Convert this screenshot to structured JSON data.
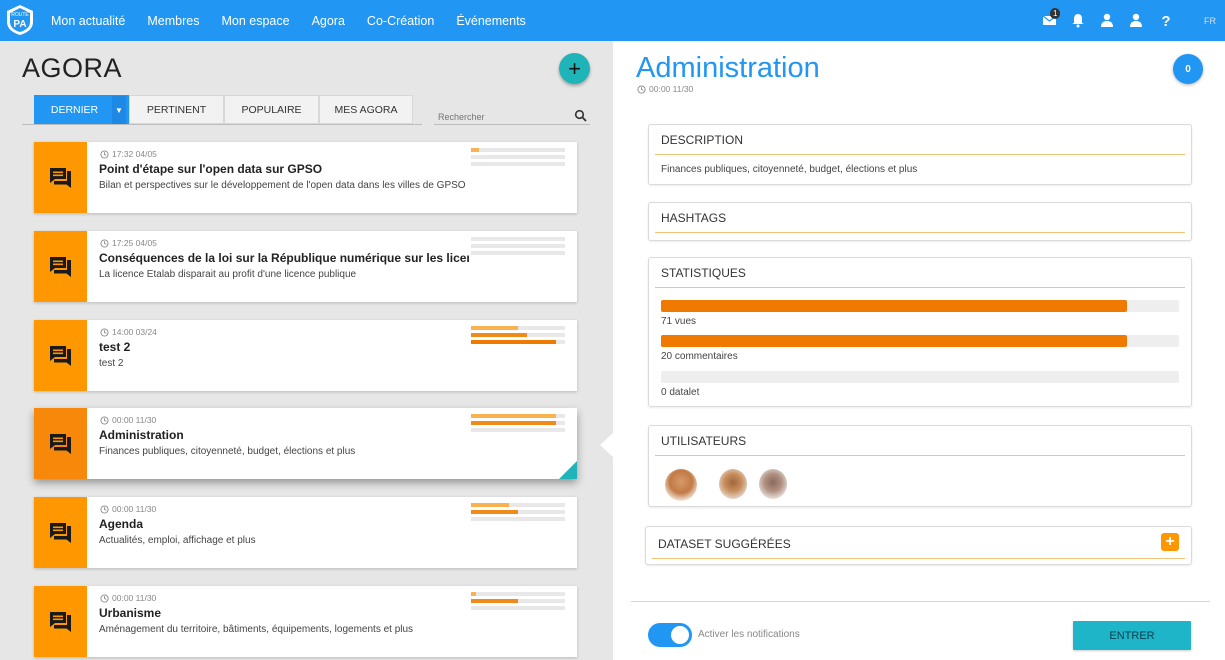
{
  "header": {
    "logo_text": "ROUTE PA",
    "nav": [
      "Mon actualité",
      "Membres",
      "Mon espace",
      "Agora",
      "Co-Création",
      "Événements"
    ],
    "icons": [
      "mail-icon",
      "bell-icon",
      "user-icon",
      "account-icon",
      "help-icon"
    ],
    "mail_badge": "1",
    "lang": "FR"
  },
  "left": {
    "title": "AGORA",
    "add_button": "+",
    "tabs": [
      "DERNIER",
      "PERTINENT",
      "POPULAIRE",
      "MES AGORA"
    ],
    "active_tab": "DERNIER",
    "search_placeholder": "Rechercher",
    "cards": [
      {
        "time": "17:32 04/05",
        "title": "Point d'étape sur l'open data sur GPSO",
        "desc": "Bilan et perspectives sur le développement de l'open data dans les villes de GPSO",
        "stats": [
          0.08,
          0,
          0
        ]
      },
      {
        "time": "17:25 04/05",
        "title": "Conséquences de la loi sur la République numérique sur les licenc...",
        "desc": "La licence Etalab disparait au profit d'une licence publique",
        "stats": [
          0,
          0,
          0
        ]
      },
      {
        "time": "14:00 03/24",
        "title": "test 2",
        "desc": "test 2",
        "stats": [
          0.5,
          0.6,
          0.9
        ]
      },
      {
        "time": "00:00 11/30",
        "title": "Administration",
        "desc": "Finances publiques, citoyenneté, budget, élections et plus",
        "stats": [
          0.9,
          0.9,
          0
        ],
        "selected": true
      },
      {
        "time": "00:00 11/30",
        "title": "Agenda",
        "desc": "Actualités, emploi, affichage et plus",
        "stats": [
          0.4,
          0.5,
          0
        ]
      },
      {
        "time": "00:00 11/30",
        "title": "Urbanisme",
        "desc": "Aménagement du territoire, bâtiments, équipements, logements et plus",
        "stats": [
          0.05,
          0.5,
          0
        ]
      }
    ]
  },
  "right": {
    "title": "Administration",
    "time": "00:00 11/30",
    "count": "0",
    "description": {
      "heading": "DESCRIPTION",
      "text": "Finances publiques, citoyenneté, budget, élections et plus"
    },
    "hashtags": {
      "heading": "HASHTAGS"
    },
    "stats": {
      "heading": "STATISTIQUES",
      "items": [
        {
          "label": "71 vues",
          "fraction": 0.9
        },
        {
          "label": "20 commentaires",
          "fraction": 0.9
        },
        {
          "label": "0 datalet",
          "fraction": 0
        }
      ]
    },
    "users": {
      "heading": "UTILISATEURS",
      "avatars": [
        "user-avatar-1",
        "user-avatar-2",
        "user-avatar-3"
      ]
    },
    "datasets": {
      "heading": "DATASET SUGGÉRÉES",
      "add": "+"
    },
    "notifications": {
      "label": "Activer les notifications",
      "enabled": true
    },
    "enter_button": "ENTRER"
  },
  "colors": {
    "primary": "#2196f3",
    "accent_orange": "#ff9800",
    "bar_orange": "#f07a00",
    "teal": "#1fb5b8"
  }
}
